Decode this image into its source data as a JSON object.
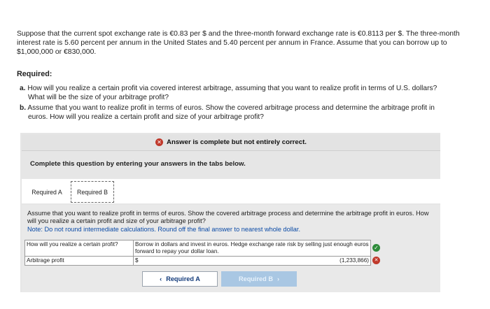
{
  "problem": {
    "text": "Suppose that the current spot exchange rate is €0.83 per $ and the three-month forward exchange rate is €0.8113 per $. The three-month interest rate is 5.60 percent per annum in the United States and 5.40 percent per annum in France. Assume that you can borrow up to $1,000,000 or €830,000."
  },
  "required": {
    "heading": "Required:",
    "a_prefix": "a.",
    "a_line1": "How will you realize a certain profit via covered interest arbitrage, assuming that you want to realize profit in terms of U.S. dollars?",
    "a_line2": "What will be the size of your arbitrage profit?",
    "b_prefix": "b.",
    "b_line1": "Assume that you want to realize profit in terms of euros. Show the covered arbitrage process and determine the arbitrage profit in",
    "b_line2": "euros. How will you realize a certain profit and size of your arbitrage profit?"
  },
  "banner": {
    "icon": "x-circle-icon",
    "text": "Answer is complete but not entirely correct."
  },
  "instruction_heading": "Complete this question by entering your answers in the tabs below.",
  "tabs": [
    {
      "label": "Required A"
    },
    {
      "label": "Required B"
    }
  ],
  "part_b": {
    "prompt": "Assume that you want to realize profit in terms of euros. Show the covered arbitrage process and determine the arbitrage profit in euros. How will you realize a certain profit and size of your arbitrage profit?",
    "note": "Note: Do not round intermediate calculations. Round off the final answer to nearest whole dollar."
  },
  "answers": {
    "row1_label": "How will you realize a certain profit?",
    "row1_value": "Borrow in dollars and invest in euros. Hedge exchange rate risk by selling just enough euros forward to repay your dollar loan.",
    "row1_status": "correct",
    "row2_label": "Arbitrage profit",
    "row2_currency": "$",
    "row2_value": "(1,233,866)",
    "row2_status": "incorrect"
  },
  "nav": {
    "prev_label": "Required A",
    "next_label": "Required B"
  },
  "colors": {
    "correct": "#2e8b3a",
    "incorrect": "#c0392b",
    "note": "#0a4aa6",
    "prev_button_text": "#123a7a",
    "next_button_bg": "#a9c7e3"
  }
}
